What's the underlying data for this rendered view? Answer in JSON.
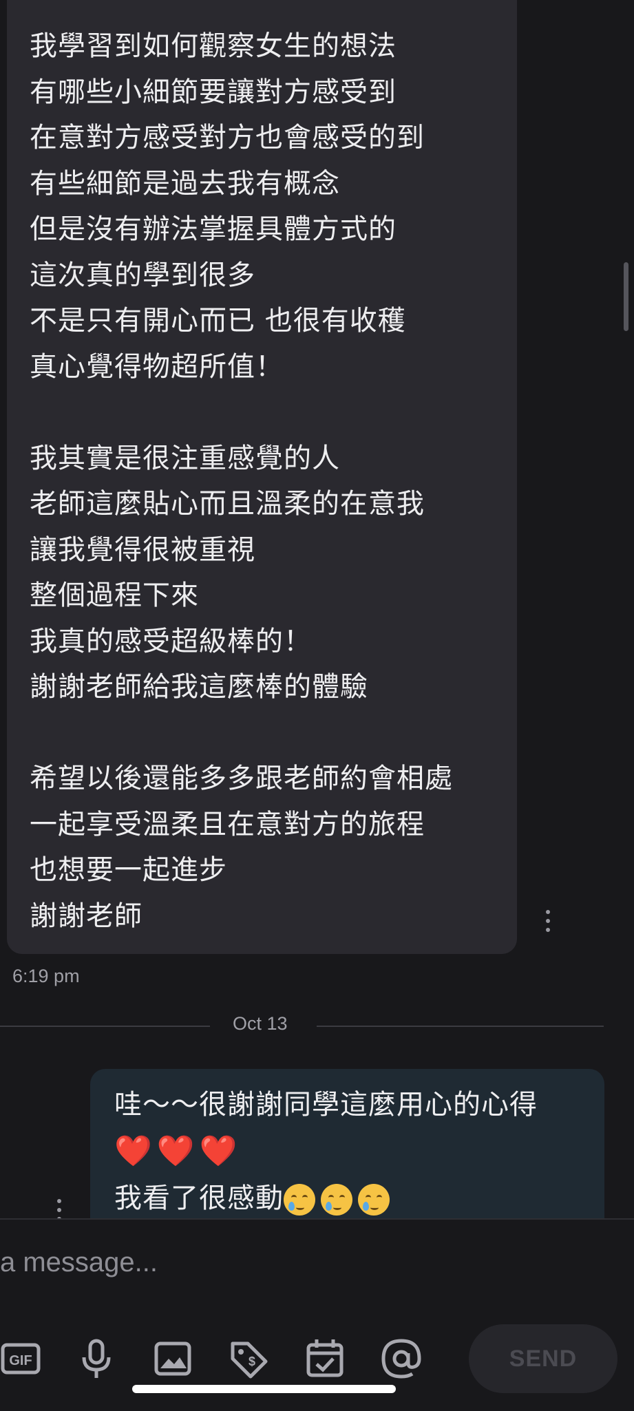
{
  "incoming_message": {
    "lines": [
      "我學習到如何觀察女生的想法",
      "有哪些小細節要讓對方感受到",
      "在意對方感受對方也會感受的到",
      "有些細節是過去我有概念",
      "但是沒有辦法掌握具體方式的",
      "這次真的學到很多",
      "不是只有開心而已 也很有收穫",
      "真心覺得物超所值！",
      "",
      "我其實是很注重感覺的人",
      "老師這麼貼心而且溫柔的在意我",
      "讓我覺得很被重視",
      "整個過程下來",
      "我真的感受超級棒的！",
      "謝謝老師給我這麼棒的體驗",
      "",
      "希望以後還能多多跟老師約會相處",
      "一起享受溫柔且在意對方的旅程",
      "也想要一起進步",
      "謝謝老師"
    ],
    "timestamp": "6:19 pm"
  },
  "date_divider": "Oct 13",
  "outgoing_message": {
    "line1": "哇～～很謝謝同學這麼用心的心得",
    "hearts": [
      "❤️",
      "❤️",
      "❤️"
    ],
    "line3": "我看了很感動",
    "emoji_icons": [
      "crying-face-icon",
      "crying-face-icon",
      "crying-face-icon"
    ]
  },
  "composer": {
    "placeholder": "a message...",
    "send_label": "SEND",
    "tools": [
      "gif-icon",
      "microphone-icon",
      "image-icon",
      "price-tag-icon",
      "calendar-check-icon",
      "at-sign-icon"
    ]
  },
  "colors": {
    "background": "#18181b",
    "incoming_bubble": "#2a292f",
    "outgoing_bubble": "#1f2a33",
    "send_button": "#26262b"
  }
}
